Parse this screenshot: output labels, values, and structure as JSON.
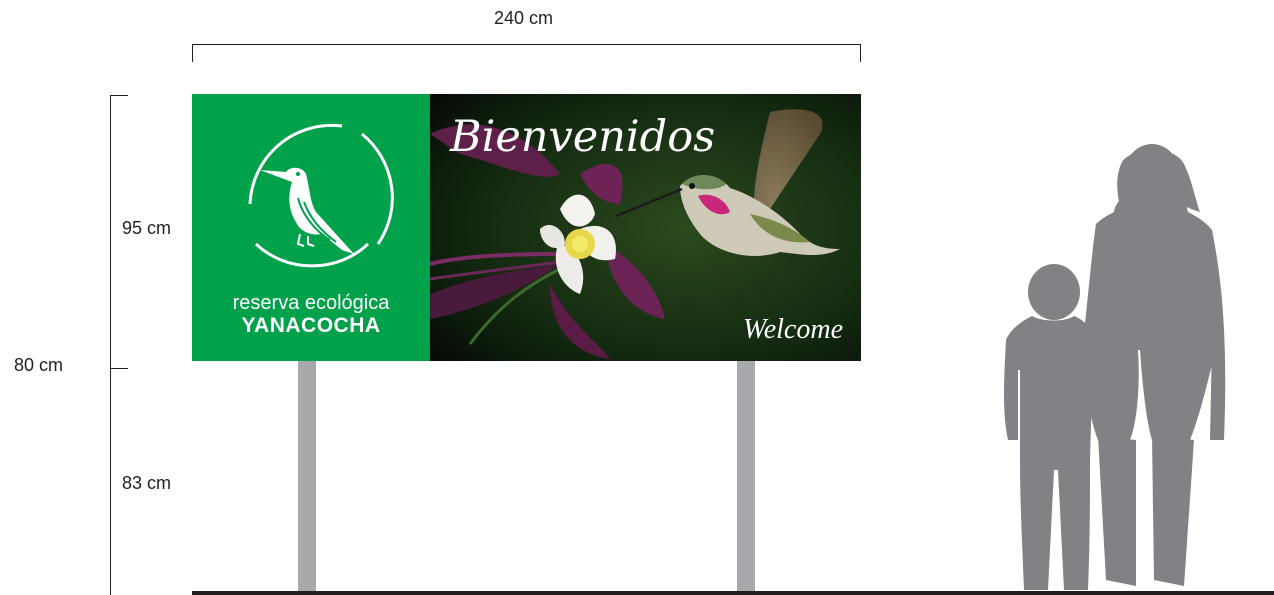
{
  "dimensions": {
    "width_label": "240 cm",
    "sign_height_label": "95 cm",
    "total_label": "80 cm",
    "post_height_label": "83 cm"
  },
  "sign": {
    "logo_line1": "reserva ecológica",
    "logo_line2": "YANACOCHA",
    "title": "Bienvenidos",
    "subtitle": "Welcome"
  },
  "colors": {
    "logo_green": "#00a14b",
    "post_gray": "#a7a9ac",
    "silhouette_gray": "#808285",
    "line_dark": "#231f20"
  },
  "icons": {
    "logo": "hummingbird-logo-icon",
    "photo": "hummingbird-and-columbine-flower-photo",
    "scale_figures": "adult-and-child-silhouette"
  }
}
